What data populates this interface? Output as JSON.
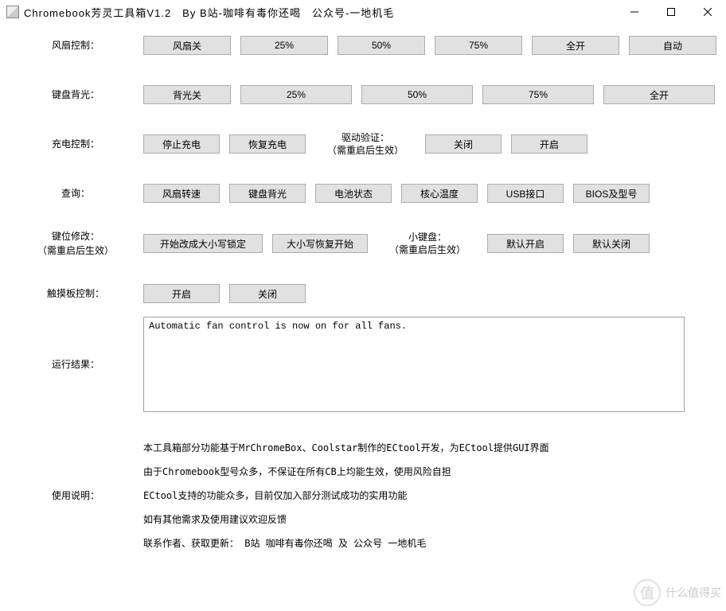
{
  "window": {
    "title": "Chromebook芳灵工具箱V1.2　By B站-咖啡有毒你还喝　公众号-一地机毛"
  },
  "rows": {
    "fan": {
      "label": "风扇控制：",
      "buttons": [
        "风扇关",
        "25%",
        "50%",
        "75%",
        "全开",
        "自动"
      ]
    },
    "keyboard": {
      "label": "键盘背光：",
      "buttons": [
        "背光关",
        "25%",
        "50%",
        "75%",
        "全开"
      ]
    },
    "charge": {
      "label": "充电控制：",
      "stop": "停止充电",
      "resume": "恢复充电",
      "drv_label": "驱动验证：\n（需重启后生效）",
      "off": "关闭",
      "on": "开启"
    },
    "query": {
      "label": "查询：",
      "buttons": [
        "风扇转速",
        "键盘背光",
        "电池状态",
        "核心温度",
        "USB接口",
        "BIOS及型号"
      ]
    },
    "keymod": {
      "label": "键位修改：\n（需重启后生效）",
      "caps_lock": "开始改成大小写锁定",
      "caps_restore": "大小写恢复开始",
      "numpad_label": "小键盘：\n（需重启后生效）",
      "default_on": "默认开启",
      "default_off": "默认关闭"
    },
    "touchpad": {
      "label": "触摸板控制：",
      "on": "开启",
      "off": "关闭"
    },
    "result": {
      "label": "运行结果：",
      "text": "Automatic fan control is now on for all fans."
    },
    "instructions": {
      "label": "使用说明：",
      "lines": [
        "本工具箱部分功能基于MrChromeBox、Coolstar制作的ECtool开发，为ECtool提供GUI界面",
        "由于Chromebook型号众多，不保证在所有CB上均能生效，使用风险自担",
        "ECtool支持的功能众多，目前仅加入部分测试成功的实用功能",
        "如有其他需求及使用建议欢迎反馈",
        "联系作者、获取更新：  B站 咖啡有毒你还喝  及 公众号 一地机毛"
      ]
    }
  },
  "watermark": "什么值得买"
}
